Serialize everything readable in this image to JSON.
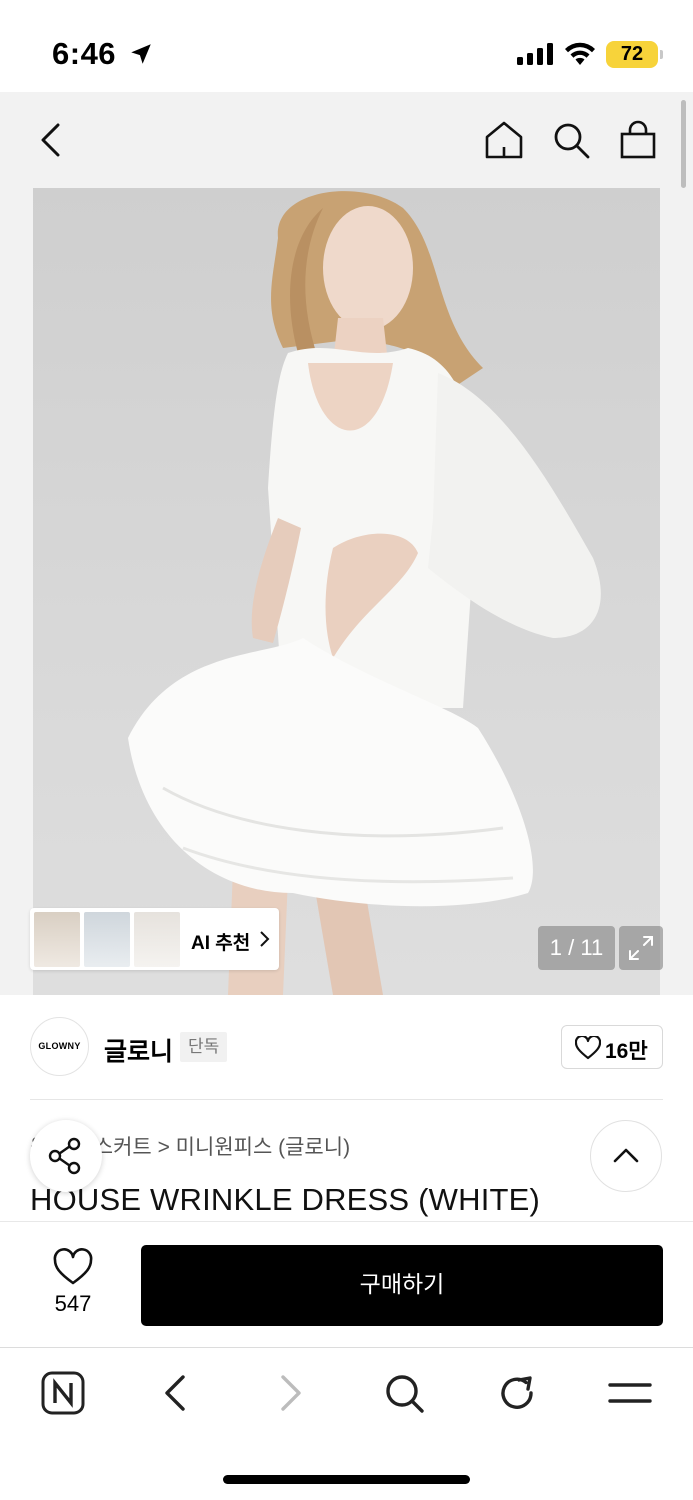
{
  "status_bar": {
    "time": "6:46",
    "battery": "72"
  },
  "header": {
    "back": "back-icon",
    "home": "home-icon",
    "search": "search-icon",
    "cart": "shopping-bag-icon"
  },
  "gallery": {
    "counter": "1 / 11",
    "ai_recommend_label": "AI 추천"
  },
  "brand": {
    "logo_text": "GLOWNY",
    "name": "글로니",
    "badge": "단독",
    "likes": "16만"
  },
  "product": {
    "breadcrumb": "원피스/스커트 > 미니원피스 (글로니)",
    "title": "HOUSE WRINKLE DRESS (WHITE)"
  },
  "purchase": {
    "like_count": "547",
    "buy_label": "구매하기"
  },
  "browser_toolbar": {
    "items": [
      "naver-icon",
      "back-icon",
      "forward-icon",
      "search-icon",
      "refresh-icon",
      "menu-icon"
    ]
  },
  "colors": {
    "accent": "#000000",
    "battery": "#f7d33a",
    "header_bg": "#f2f2f2"
  }
}
